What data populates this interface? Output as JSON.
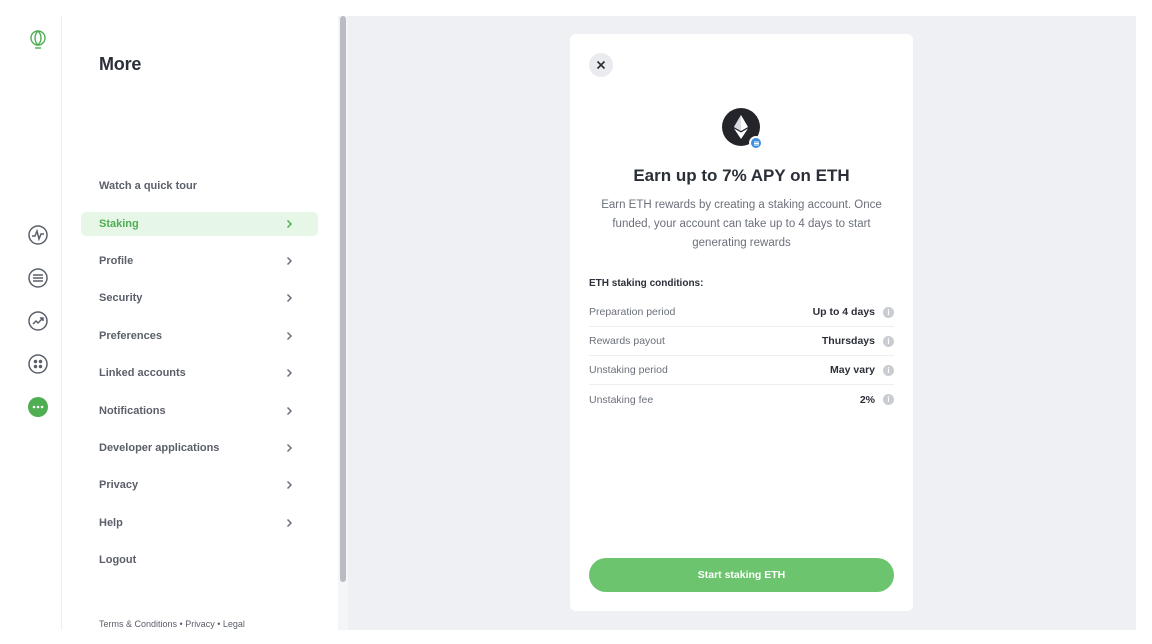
{
  "rail": {
    "icons": [
      "uphold-logo-icon",
      "activity-icon",
      "transactions-list-icon",
      "portfolio-trend-icon",
      "apps-grid-icon",
      "more-icon"
    ]
  },
  "menu": {
    "title": "More",
    "tour": "Watch a quick tour",
    "items": [
      {
        "label": "Staking",
        "active": true
      },
      {
        "label": "Profile"
      },
      {
        "label": "Security"
      },
      {
        "label": "Preferences"
      },
      {
        "label": "Linked accounts"
      },
      {
        "label": "Notifications"
      },
      {
        "label": "Developer applications"
      },
      {
        "label": "Privacy"
      },
      {
        "label": "Help"
      }
    ],
    "logout": "Logout",
    "footer": {
      "terms": "Terms & Conditions",
      "privacy": "Privacy",
      "legal": "Legal",
      "sep": " • "
    }
  },
  "card": {
    "title": "Earn up to 7% APY on ETH",
    "description": "Earn ETH rewards by creating a staking account. Once funded, your account can take up to 4 days to start generating rewards",
    "conditions_title": "ETH staking conditions:",
    "conditions": [
      {
        "key": "Preparation period",
        "value": "Up to 4 days"
      },
      {
        "key": "Rewards payout",
        "value": "Thursdays"
      },
      {
        "key": "Unstaking period",
        "value": "May vary"
      },
      {
        "key": "Unstaking fee",
        "value": "2%"
      }
    ],
    "info_glyph": "i",
    "cta": "Start staking ETH"
  },
  "colors": {
    "accent": "#6cc46e",
    "active_bg": "#e6f7e7",
    "active_text": "#4fae52",
    "background": "#eef0f3"
  }
}
